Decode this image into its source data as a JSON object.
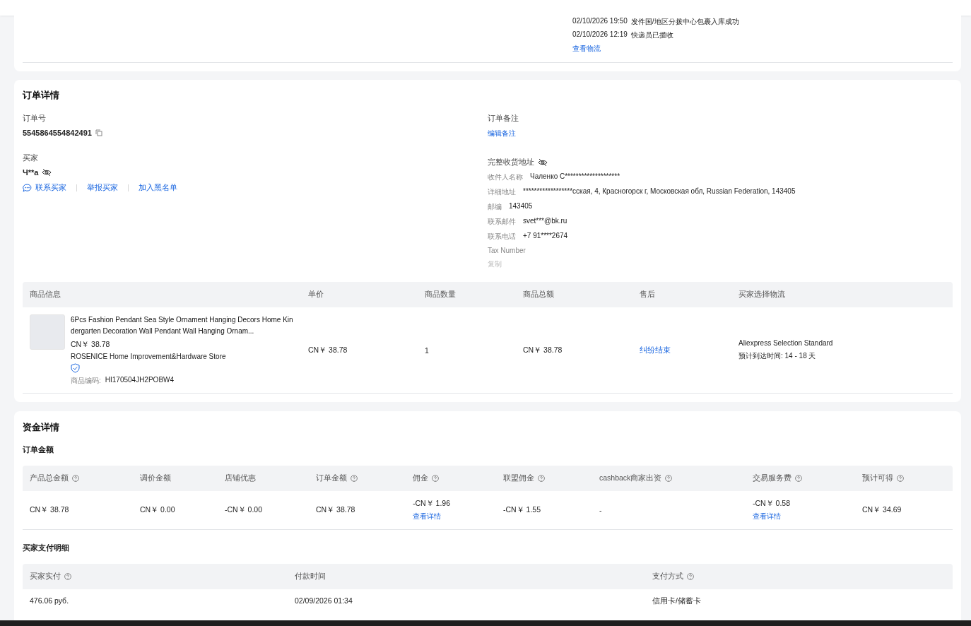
{
  "tracking": {
    "events": [
      {
        "time": "02/10/2026 19:50",
        "text": "发件国/地区分拨中心包裹入库成功"
      },
      {
        "time": "02/10/2026 12:19",
        "text": "快递员已揽收"
      }
    ],
    "link": "查看物流"
  },
  "order_details": {
    "title": "订单详情",
    "order_no_label": "订单号",
    "order_no": "5545864554842491",
    "buyer_label": "买家",
    "buyer_name": "Ч**a",
    "buyer_actions": [
      {
        "kind": "chat",
        "label": "联系买家"
      },
      {
        "kind": "plain",
        "label": "举报买家"
      },
      {
        "kind": "plain",
        "label": "加入黑名单"
      }
    ],
    "remark_label": "订单备注",
    "remark_link": "编辑备注",
    "address_label": "完整收货地址",
    "address_fields": [
      {
        "label": "收件人名称",
        "value": "Чаленко С********************"
      },
      {
        "label": "详细地址",
        "value": "******************сская, 4, Красногорск г, Московская обл, Russian Federation, 143405"
      },
      {
        "label": "邮编",
        "value": "143405"
      },
      {
        "label": "联系邮件",
        "value": "svet***@bk.ru"
      },
      {
        "label": "联系电话",
        "value": "+7 91****2674"
      }
    ],
    "tax_label": "Tax Number",
    "copy_link": "复制"
  },
  "products": {
    "columns": [
      "商品信息",
      "单价",
      "商品数量",
      "商品总额",
      "售后",
      "买家选择物流"
    ],
    "rows": [
      {
        "title": "6Pcs Fashion Pendant Sea Style Ornament Hanging Decors Home Kindergarten Decoration Wall Pendant Wall Hanging Ornam...",
        "price": "CN￥ 38.78",
        "store": "ROSENICE Home Improvement&Hardware Store",
        "code_label": "商品编码:",
        "code": "HI170504JH2POBW4",
        "unit_price": "CN￥ 38.78",
        "qty": "1",
        "total": "CN￥ 38.78",
        "after_sale": "纠纷结束",
        "shipping": "Aliexpress Selection Standard",
        "eta": "预计到达时间: 14 - 18 天"
      }
    ]
  },
  "funds": {
    "title": "资金详情",
    "amount_title": "订单金额",
    "columns": [
      {
        "label": "产品总金额",
        "help": true
      },
      {
        "label": "调价金额",
        "help": false
      },
      {
        "label": "店铺优惠",
        "help": false
      },
      {
        "label": "订单金额",
        "help": true
      },
      {
        "label": "佣金",
        "help": true
      },
      {
        "label": "联盟佣金",
        "help": true
      },
      {
        "label": "cashback商家出资",
        "help": true
      },
      {
        "label": "交易服务费",
        "help": true
      },
      {
        "label": "预计可得",
        "help": true
      }
    ],
    "cells": [
      {
        "value": "CN￥ 38.78"
      },
      {
        "value": "CN￥ 0.00"
      },
      {
        "value": "-CN￥ 0.00"
      },
      {
        "value": "CN￥ 38.78"
      },
      {
        "value": "-CN￥ 1.96",
        "link": "查看详情"
      },
      {
        "value": "-CN￥ 1.55"
      },
      {
        "value": "-"
      },
      {
        "value": "-CN￥ 0.58",
        "link": "查看详情"
      },
      {
        "value": "CN￥ 34.69"
      }
    ],
    "payment_title": "买家支付明细",
    "payment_columns": [
      {
        "label": "买家实付",
        "help": true
      },
      {
        "label": "付款时间",
        "help": false
      },
      {
        "label": "支付方式",
        "help": true
      }
    ],
    "payment_cells": [
      "476.06 руб.",
      "02/09/2026 01:34",
      "信用卡/储蓄卡"
    ]
  }
}
